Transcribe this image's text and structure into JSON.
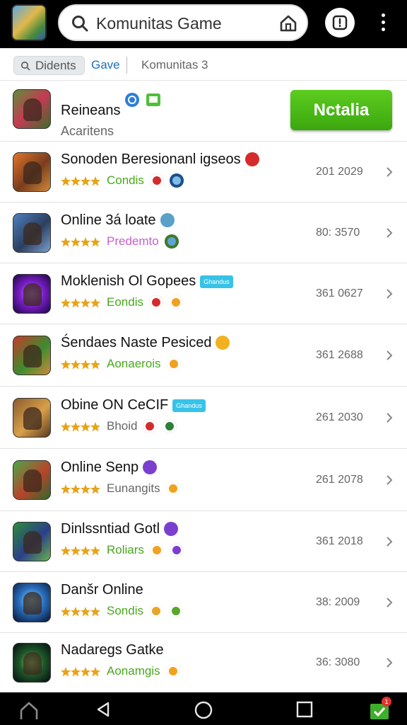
{
  "header": {
    "search_text": "Komunitas Game",
    "logo_icon": "game-app-logo-icon",
    "store_icon": "store-house-icon",
    "shield_icon": "shield-icon",
    "more_icon": "more-vertical-icon"
  },
  "filters": {
    "chip_label": "Didents",
    "tab_active": "Gave",
    "tab_other": "Komunitas 3"
  },
  "featured": {
    "title": "Reineans",
    "subtitle": "Acaritens",
    "install_label": "Nctalia",
    "accent": "#48b816"
  },
  "games": [
    {
      "title": "Sonoden Beresionanl igseos",
      "sub": "Condis",
      "sub_color": "#48a81c",
      "meta": "201 2029",
      "rating": 4
    },
    {
      "title": "Online 3á loate",
      "sub": "Predemto",
      "sub_color": "#c65ecf",
      "meta": "80: 3570",
      "rating": 4
    },
    {
      "title": "Moklenish Ol Gopees",
      "sub": "Eondis",
      "sub_color": "#48a81c",
      "meta": "361 0627",
      "rating": 4,
      "tag": "Ghandus"
    },
    {
      "title": "Śendaes Naste Pesiced",
      "sub": "Aonaerois",
      "sub_color": "#48a81c",
      "meta": "361 2688",
      "rating": 4
    },
    {
      "title": "Obine ON CeCIF",
      "sub": "Bhoid",
      "sub_color": "#666666",
      "meta": "261 2030",
      "rating": 4,
      "tag": "Ghandus"
    },
    {
      "title": "Online Senp",
      "sub": "Eunangits",
      "sub_color": "#666666",
      "meta": "261 2078",
      "rating": 4
    },
    {
      "title": "Dinlssntiad Gotl",
      "sub": "Roliars",
      "sub_color": "#48a81c",
      "meta": "361 2018",
      "rating": 4
    },
    {
      "title": "Danšr Online",
      "sub": "Sondis",
      "sub_color": "#48a81c",
      "meta": "38: 2009",
      "rating": 4
    },
    {
      "title": "Nadaregs Gatke",
      "sub": "Aonamgis",
      "sub_color": "#48a81c",
      "meta": "36: 3080",
      "rating": 4
    }
  ],
  "navbar": {
    "notification_count": "1",
    "icons": [
      "home-icon",
      "back-icon",
      "home-circle-icon",
      "recents-icon",
      "downloads-icon"
    ]
  }
}
